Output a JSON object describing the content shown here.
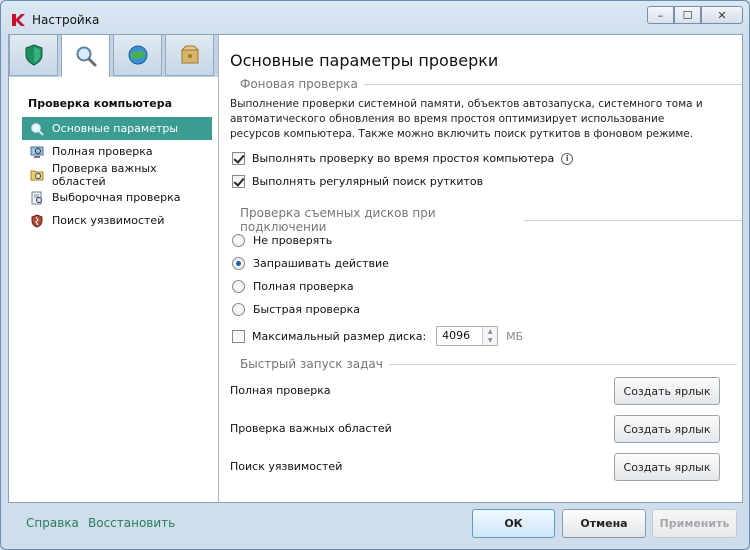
{
  "window": {
    "title": "Настройка"
  },
  "sidebar": {
    "tabs": [
      {
        "icon": "shield-icon"
      },
      {
        "icon": "magnifier-icon"
      },
      {
        "icon": "globe-icon"
      },
      {
        "icon": "box-icon"
      }
    ],
    "heading": "Проверка компьютера",
    "items": [
      {
        "label": "Основные параметры",
        "icon": "magnifier-icon"
      },
      {
        "label": "Полная проверка",
        "icon": "computer-scan-icon"
      },
      {
        "label": "Проверка важных областей",
        "icon": "folder-scan-icon"
      },
      {
        "label": "Выборочная проверка",
        "icon": "custom-scan-icon"
      },
      {
        "label": "Поиск уязвимостей",
        "icon": "vulnerability-icon"
      }
    ]
  },
  "main": {
    "title": "Основные параметры проверки",
    "background_scan": {
      "heading": "Фоновая проверка",
      "description": "Выполнение проверки системной памяти, объектов автозапуска, системного тома и автоматического обновления во время простоя оптимизирует использование ресурсов компьютера. Также можно включить поиск руткитов в фоновом режиме.",
      "option_idle": "Выполнять проверку во время простоя компьютера",
      "option_rootkits": "Выполнять регулярный поиск руткитов"
    },
    "removable": {
      "heading": "Проверка съемных дисков при подключении",
      "options": [
        "Не проверять",
        "Запрашивать действие",
        "Полная проверка",
        "Быстрая проверка"
      ],
      "selected": "Запрашивать действие",
      "max_size_label": "Максимальный размер диска:",
      "max_size_value": "4096",
      "max_size_unit": "МБ"
    },
    "quick_launch": {
      "heading": "Быстрый запуск задач",
      "tasks": [
        "Полная проверка",
        "Проверка важных областей",
        "Поиск уязвимостей"
      ],
      "button_label": "Создать ярлык"
    }
  },
  "footer": {
    "help": "Справка",
    "restore": "Восстановить",
    "ok": "ОК",
    "cancel": "Отмена",
    "apply": "Применить"
  },
  "colors": {
    "selected_item": "#3b9d92",
    "link": "#2d7d57",
    "radio_dot": "#1d5fb8"
  }
}
